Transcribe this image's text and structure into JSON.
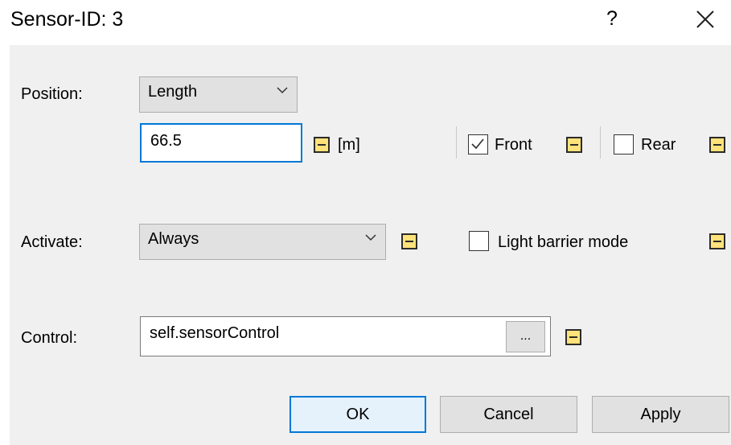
{
  "window": {
    "title": "Sensor-ID: 3",
    "help_label": "?"
  },
  "position": {
    "label": "Position:",
    "mode_value": "Length",
    "value": "66.5",
    "unit": "[m]",
    "front_label": "Front",
    "front_checked": true,
    "rear_label": "Rear",
    "rear_checked": false
  },
  "activate": {
    "label": "Activate:",
    "value": "Always",
    "light_barrier_label": "Light barrier mode",
    "light_barrier_checked": false
  },
  "control": {
    "label": "Control:",
    "value": "self.sensorControl",
    "browse_label": "..."
  },
  "buttons": {
    "ok": "OK",
    "cancel": "Cancel",
    "apply": "Apply"
  },
  "colors": {
    "lock_fill": "#ffe27a",
    "focus_border": "#0078d7"
  }
}
